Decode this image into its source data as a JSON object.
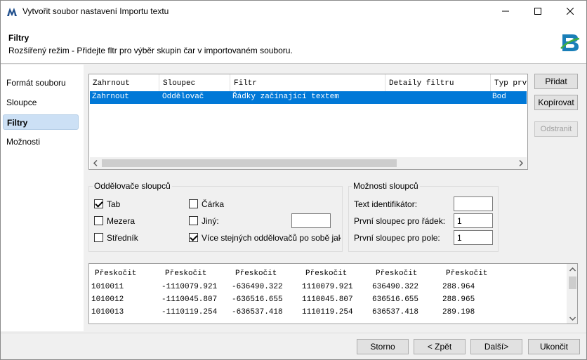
{
  "window": {
    "title": "Vytvořit soubor nastavení Importu textu"
  },
  "header": {
    "title": "Filtry",
    "subtitle": "Rozšířený režim - Přidejte fltr pro výběr skupin čar v importovaném souboru."
  },
  "nav": {
    "items": [
      "Formát souboru",
      "Sloupce",
      "Filtry",
      "Možnosti"
    ],
    "active_index": 2
  },
  "filter_table": {
    "columns": [
      "Zahrnout",
      "Sloupec",
      "Filtr",
      "Detaily filtru",
      "Typ prvku"
    ],
    "rows": [
      [
        "Zahrnout",
        "Oddělovač",
        "Řádky začínající textem",
        "",
        "Bod"
      ]
    ]
  },
  "side_buttons": {
    "add": "Přidat",
    "copy": "Kopírovat",
    "remove": "Odstranit"
  },
  "separators": {
    "title": "Oddělovače sloupců",
    "tab": {
      "label": "Tab",
      "checked": true
    },
    "space": {
      "label": "Mezera",
      "checked": false
    },
    "semicolon": {
      "label": "Středník",
      "checked": false
    },
    "comma": {
      "label": "Čárka",
      "checked": false
    },
    "other": {
      "label": "Jiný:",
      "checked": false,
      "value": ""
    },
    "multiple": {
      "label": "Více stejných oddělovačů po sobě jako jeden",
      "checked": true
    }
  },
  "column_options": {
    "title": "Možnosti sloupců",
    "text_id": {
      "label": "Text identifikátor:",
      "value": ""
    },
    "first_col_row": {
      "label": "První sloupec pro řádek:",
      "value": "1"
    },
    "first_col_field": {
      "label": "První sloupec pro pole:",
      "value": "1"
    }
  },
  "preview": {
    "columns": [
      "Přeskočit",
      "Přeskočit",
      "Přeskočit",
      "Přeskočit",
      "Přeskočit",
      "Přeskočit"
    ],
    "rows": [
      [
        "1010011",
        "-1110079.921",
        "-636490.322",
        "1110079.921",
        "636490.322",
        "288.964"
      ],
      [
        "1010012",
        "-1110045.807",
        "-636516.655",
        "1110045.807",
        "636516.655",
        "288.965"
      ],
      [
        "1010013",
        "-1110119.254",
        "-636537.418",
        "1110119.254",
        "636537.418",
        "289.198"
      ]
    ]
  },
  "footer": {
    "cancel": "Storno",
    "back": "< Zpět",
    "next": "Další>",
    "finish": "Ukončit"
  },
  "colors": {
    "selection": "#0078d7",
    "nav_active": "#cce0f5"
  }
}
